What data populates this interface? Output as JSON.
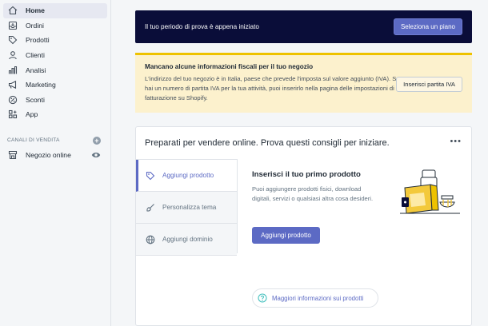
{
  "sidebar": {
    "items": [
      {
        "label": "Home",
        "icon": "home-icon",
        "active": true
      },
      {
        "label": "Ordini",
        "icon": "orders-icon"
      },
      {
        "label": "Prodotti",
        "icon": "tag-icon"
      },
      {
        "label": "Clienti",
        "icon": "user-icon"
      },
      {
        "label": "Analisi",
        "icon": "analytics-icon"
      },
      {
        "label": "Marketing",
        "icon": "megaphone-icon"
      },
      {
        "label": "Sconti",
        "icon": "discount-icon"
      },
      {
        "label": "App",
        "icon": "apps-icon"
      }
    ],
    "channels_heading": "CANALI DI VENDITA",
    "channels": [
      {
        "label": "Negozio online",
        "icon": "store-icon"
      }
    ]
  },
  "trial_banner": {
    "text": "Il tuo periodo di prova è appena iniziato",
    "button": "Seleziona un piano"
  },
  "tax_banner": {
    "title": "Mancano alcune informazioni fiscali per il tuo negozio",
    "body": "L'indirizzo del tuo negozio è in Italia, paese che prevede l'imposta sul valore aggiunto (IVA). Se hai un numero di partita IVA per la tua attività, puoi inserirlo nella pagina delle impostazioni di fatturazione su Shopify.",
    "button": "Inserisci partita IVA"
  },
  "setup_card": {
    "title": "Preparati per vendere online. Prova questi consigli per iniziare.",
    "more": "•••",
    "tabs": [
      {
        "label": "Aggiungi prodotto",
        "icon": "tag-icon",
        "active": true
      },
      {
        "label": "Personalizza tema",
        "icon": "brush-icon"
      },
      {
        "label": "Aggiungi dominio",
        "icon": "globe-icon"
      }
    ],
    "pane": {
      "title": "Inserisci il tuo primo prodotto",
      "body": "Puoi aggiungere prodotti fisici, download digitali, servizi o qualsiasi altra cosa desideri.",
      "button": "Aggiungi prodotto",
      "more_info": "Maggiori informazioni sui prodotti"
    }
  },
  "colors": {
    "accent": "#5c6ac4",
    "dark_banner": "#0a0d39",
    "warning_bg": "#fcf1cd",
    "warning_border": "#eec200"
  }
}
